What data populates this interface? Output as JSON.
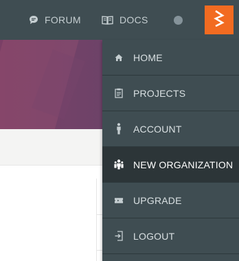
{
  "topbar": {
    "forum_label": "FORUM",
    "docs_label": "DOCS",
    "brand_color": "#f26b21"
  },
  "menu": {
    "items": [
      {
        "label": "HOME",
        "icon": "home-icon"
      },
      {
        "label": "PROJECTS",
        "icon": "clipboard-icon"
      },
      {
        "label": "ACCOUNT",
        "icon": "person-icon"
      },
      {
        "label": "NEW ORGANIZATION",
        "icon": "group-icon",
        "active": true
      },
      {
        "label": "UPGRADE",
        "icon": "ticket-icon"
      },
      {
        "label": "LOGOUT",
        "icon": "logout-icon"
      }
    ]
  },
  "colors": {
    "navbar": "#3f4d52",
    "menu_active": "#2c3538",
    "hero": "#6a4469"
  }
}
